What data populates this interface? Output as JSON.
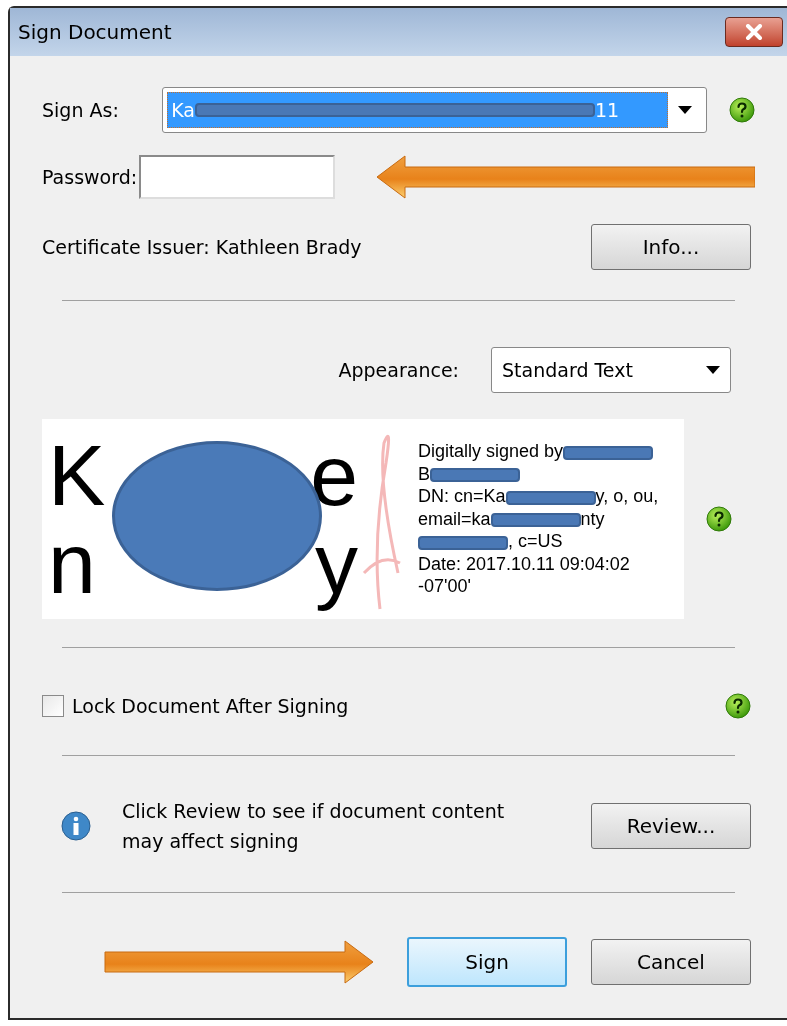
{
  "window": {
    "title": "Sign Document"
  },
  "sign_as": {
    "label": "Sign As:",
    "value": [
      {
        "kind": "text",
        "text": "Ka"
      },
      {
        "kind": "redaction"
      },
      {
        "kind": "text",
        "text": "11"
      }
    ]
  },
  "password": {
    "label": "Password:"
  },
  "certificate_issuer": "Certificate Issuer: Kathleen Brady",
  "info_button": "Info...",
  "appearance": {
    "label": "Appearance:",
    "value": "Standard Text"
  },
  "signature_preview": {
    "name_fragments": [
      [
        "K",
        "e"
      ],
      [
        "n",
        "y"
      ]
    ],
    "details": [
      [
        {
          "kind": "text",
          "text": "Digitally signed by"
        },
        {
          "kind": "redaction"
        }
      ],
      [
        {
          "kind": "text",
          "text": "B"
        },
        {
          "kind": "redaction"
        }
      ],
      [
        {
          "kind": "text",
          "text": "DN: cn=Ka"
        },
        {
          "kind": "redaction"
        },
        {
          "kind": "text",
          "text": "y, o, ou,"
        }
      ],
      [
        {
          "kind": "text",
          "text": "email=ka"
        },
        {
          "kind": "redaction"
        },
        {
          "kind": "text",
          "text": "nty"
        }
      ],
      [
        {
          "kind": "redaction"
        },
        {
          "kind": "text",
          "text": ", c=US"
        }
      ],
      [
        {
          "kind": "text",
          "text": "Date: 2017.10.11 09:04:02"
        }
      ],
      [
        {
          "kind": "text",
          "text": "-07'00'"
        }
      ]
    ]
  },
  "lock_document": {
    "label": "Lock Document After Signing",
    "checked": false
  },
  "review": {
    "message": "Click Review to see if document content may affect signing",
    "button": "Review..."
  },
  "buttons": [
    {
      "label": "Sign",
      "selected": true
    },
    {
      "label": "Cancel",
      "selected": false
    }
  ]
}
